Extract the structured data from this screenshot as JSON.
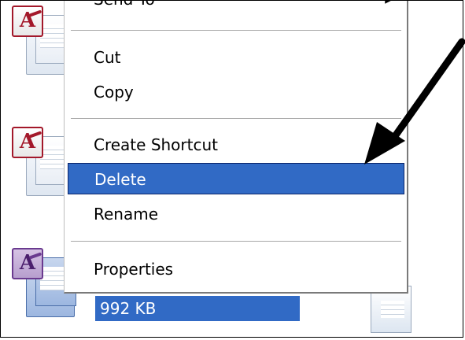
{
  "context_menu": {
    "items": [
      {
        "label": "Send To",
        "has_submenu": true
      },
      {
        "label": "Cut"
      },
      {
        "label": "Copy"
      },
      {
        "label": "Create Shortcut"
      },
      {
        "label": "Delete",
        "highlighted": true
      },
      {
        "label": "Rename"
      },
      {
        "label": "Properties"
      }
    ],
    "highlight_color": "#316ac5"
  },
  "selected_file": {
    "size": "992 KB",
    "icon": "access-database-icon"
  },
  "annotation": {
    "type": "arrow",
    "points_to": "Delete",
    "color": "#000000"
  }
}
